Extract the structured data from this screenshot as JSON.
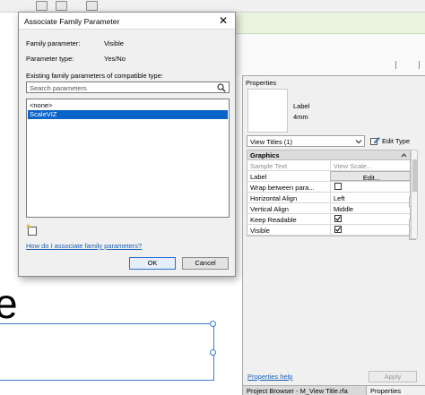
{
  "dialog": {
    "title": "Associate Family Parameter",
    "family_parameter_label": "Family parameter:",
    "family_parameter_value": "Visible",
    "parameter_type_label": "Parameter type:",
    "parameter_type_value": "Yes/No",
    "existing_label": "Existing family parameters of compatible type:",
    "search_placeholder": "Search parameters",
    "list_items": [
      "<none>",
      "ScaleVIZ"
    ],
    "selected_index": 1,
    "help_link": "How do I associate family parameters?",
    "ok_label": "OK",
    "cancel_label": "Cancel"
  },
  "canvas": {
    "big_text": "e"
  },
  "properties": {
    "title": "Properties",
    "type_family": "Label",
    "type_name": "4mm",
    "type_selector": "View Titles (1)",
    "edit_type_label": "Edit Type",
    "section_header": "Graphics",
    "rows": [
      {
        "name": "Sample Text",
        "value": "View Scale...",
        "kind": "text",
        "disabled": true
      },
      {
        "name": "Label",
        "value": "Edit...",
        "kind": "button",
        "disabled": false
      },
      {
        "name": "Wrap between para...",
        "value": "",
        "kind": "checkbox",
        "checked": false
      },
      {
        "name": "Horizontal Align",
        "value": "Left",
        "kind": "text",
        "disabled": false
      },
      {
        "name": "Vertical Align",
        "value": "Middle",
        "kind": "text",
        "disabled": false
      },
      {
        "name": "Keep Readable",
        "value": "",
        "kind": "checkbox",
        "checked": true
      },
      {
        "name": "Visible",
        "value": "",
        "kind": "checkbox",
        "checked": true
      }
    ],
    "help_link": "Properties help",
    "apply_label": "Apply",
    "bottom_tabs": [
      "Project Browser - M_View Title.rfa",
      "Properties"
    ]
  }
}
